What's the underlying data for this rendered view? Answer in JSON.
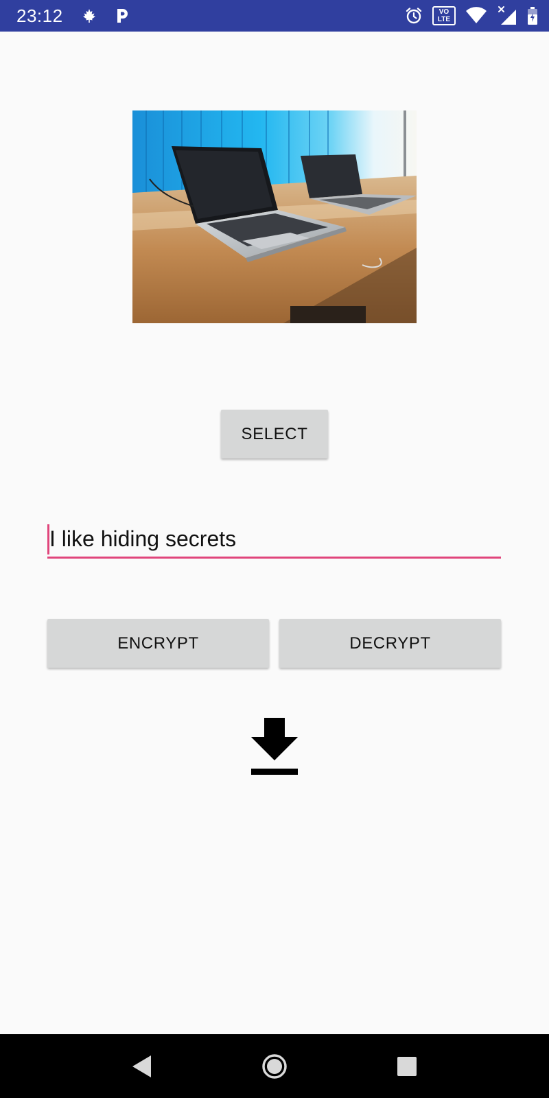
{
  "status_bar": {
    "time": "23:12",
    "volte_top": "VO",
    "volte_bottom": "LTE",
    "icons": [
      "maple-leaf-icon",
      "p-icon",
      "alarm-icon",
      "volte-icon",
      "wifi-icon",
      "signal-icon",
      "battery-icon"
    ],
    "background": "#303f9f"
  },
  "preview": {
    "image": "laptops-on-desk-photo"
  },
  "select_button": {
    "label": "SELECT"
  },
  "message_field": {
    "value": "I like hiding secrets",
    "underline_color": "#e0457b"
  },
  "encrypt_button": {
    "label": "ENCRYPT"
  },
  "decrypt_button": {
    "label": "DECRYPT"
  },
  "download": {
    "icon": "download-icon"
  },
  "nav_bar": {
    "icons": [
      "back-icon",
      "home-icon",
      "recents-icon"
    ]
  },
  "colors": {
    "accent": "#e0457b",
    "primary_dark": "#303f9f",
    "button": "#d6d7d7",
    "background": "#fafafa"
  }
}
